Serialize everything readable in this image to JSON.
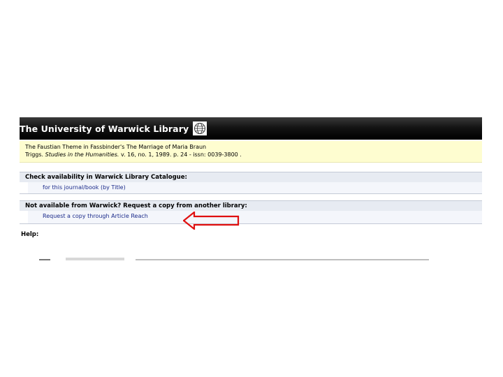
{
  "header": {
    "title": "The University of Warwick Library"
  },
  "icons": {
    "logo": "globe-icon",
    "annotation": "arrow-left-icon"
  },
  "citation": {
    "article_title": "The Faustian Theme in Fassbinder's The Marriage of Maria Braun",
    "author": "Triggs.",
    "journal": "Studies in the Humanities.",
    "details": " v. 16, no. 1,  1989. p. 24 - issn: 0039-3800 ."
  },
  "availability": {
    "heading": "Check availability in Warwick Library Catalogue:",
    "link": "for this journal/book (by Title)"
  },
  "request": {
    "heading": "Not available from Warwick? Request a copy from another library:",
    "link": "Request a copy through Article Reach"
  },
  "help": {
    "label": "Help:"
  },
  "colors": {
    "banner": "#000000",
    "citation_bg": "#fefdd0",
    "section_head_bg": "#e7ebf2",
    "link": "#1a2a8a",
    "annotation_arrow": "#e01010"
  }
}
